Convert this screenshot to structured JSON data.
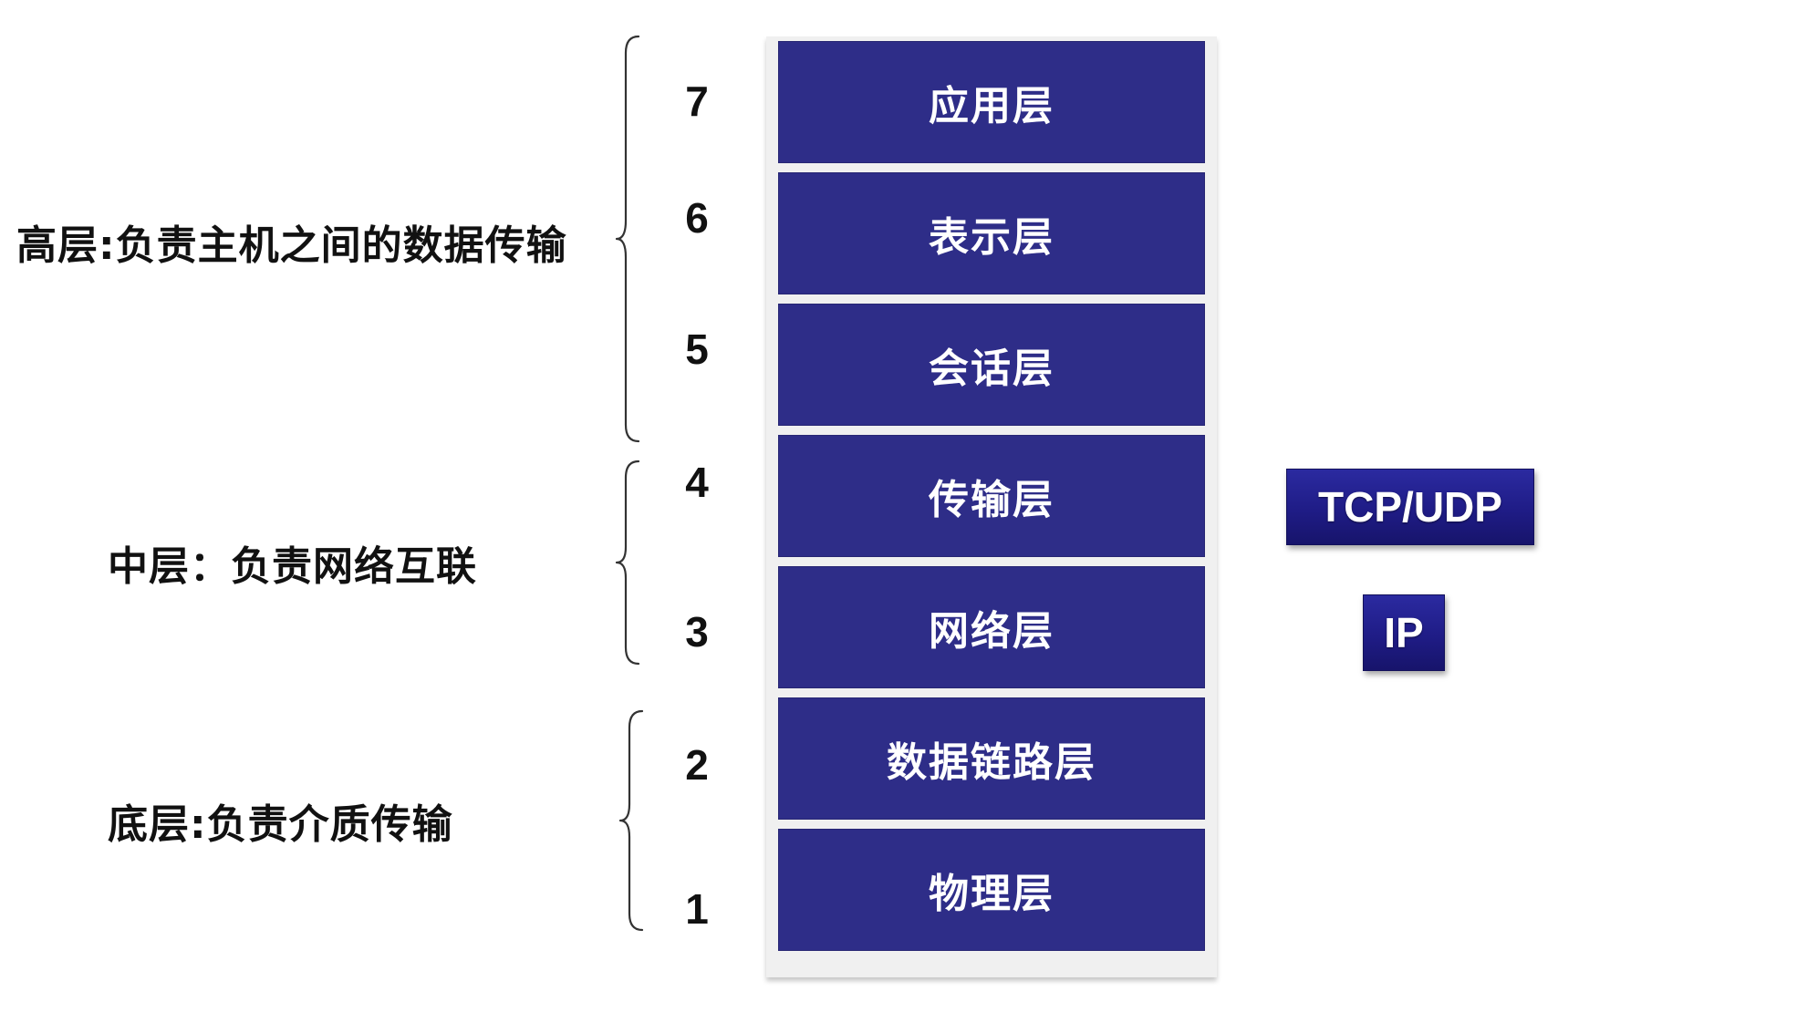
{
  "groups": {
    "high": "高层:负责主机之间的数据传输",
    "middle": "中层：负责网络互联",
    "low": "底层:负责介质传输"
  },
  "layers": [
    {
      "number": "7",
      "name": "应用层"
    },
    {
      "number": "6",
      "name": "表示层"
    },
    {
      "number": "5",
      "name": "会话层"
    },
    {
      "number": "4",
      "name": "传输层"
    },
    {
      "number": "3",
      "name": "网络层"
    },
    {
      "number": "2",
      "name": "数据链路层"
    },
    {
      "number": "1",
      "name": "物理层"
    }
  ],
  "protocols": {
    "transport": "TCP/UDP",
    "network": "IP"
  },
  "colors": {
    "layer_fill": "#2e2d88",
    "protocol_fill": "#1f1c86",
    "text_dark": "#111111",
    "text_light": "#ffffff"
  }
}
